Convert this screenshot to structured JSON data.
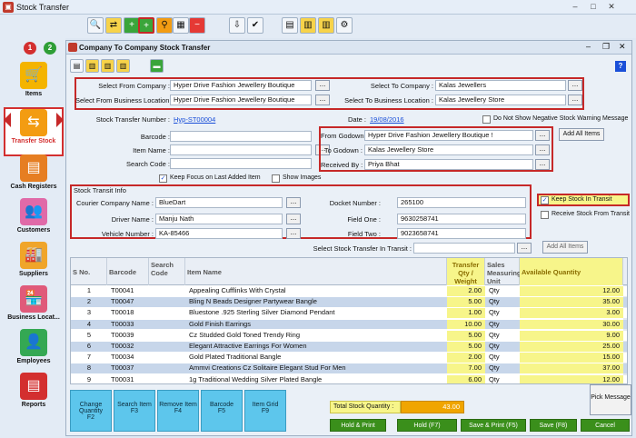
{
  "window": {
    "title": "Stock Transfer"
  },
  "sidebar": {
    "badges": [
      "1",
      "2"
    ],
    "items": [
      {
        "label": "Items"
      },
      {
        "label": "Transfer Stock"
      },
      {
        "label": "Cash Registers"
      },
      {
        "label": "Customers"
      },
      {
        "label": "Suppliers"
      },
      {
        "label": "Business Locat..."
      },
      {
        "label": "Employees"
      },
      {
        "label": "Reports"
      }
    ]
  },
  "form": {
    "title": "Company To Company Stock Transfer",
    "labels": {
      "from_company": "Select From Company :",
      "to_company": "Select To Company :",
      "from_loc": "Select From Business Location :",
      "to_loc": "Select To Business Location :",
      "transfer_no": "Stock Transfer Number :",
      "date": "Date :",
      "no_neg": "Do Not Show Negative Stock Warning Message",
      "barcode": "Barcode :",
      "item_name": "Item Name :",
      "search_code": "Search Code :",
      "from_godown": "From Godown :",
      "to_godown": "To Godown :",
      "received_by": "Received By :",
      "keep_focus": "Keep Focus on Last Added Item",
      "show_images": "Show Images",
      "transit_info": "Stock Transit Info",
      "courier": "Courier Company Name :",
      "driver": "Driver Name :",
      "vehicle": "Vehicle Number :",
      "docket": "Docket Number :",
      "field_one": "Field One :",
      "field_two": "Field Two :",
      "keep_transit": "Keep Stock In Transit",
      "receive_transit": "Receive Stock From Transit",
      "select_transit": "Select Stock Transfer In Transit :"
    },
    "values": {
      "from_company": "Hyper Drive Fashion Jewellery Boutique",
      "to_company": "Kalas Jewellers",
      "from_loc": "Hyper Drive Fashion Jewellery Boutique",
      "to_loc": "Kalas Jewellery Store",
      "transfer_no": "Hyp-ST00004",
      "date": "19/08/2016",
      "from_godown": "Hyper Drive Fashion Jewellery Boutique !",
      "to_godown": "Kalas Jewellery Store",
      "received_by": "Priya Bhat",
      "courier": "BlueDart",
      "driver": "Manju Nath",
      "vehicle": "KA-85466",
      "docket": "265100",
      "field_one": "9630258741",
      "field_two": "9023658741"
    },
    "buttons": {
      "add_all_items": "Add All Items",
      "add_all_items2": "Add All Items",
      "dots": "..."
    }
  },
  "grid": {
    "headers": [
      "S No.",
      "Barcode",
      "Search Code",
      "Item Name",
      "Transfer Qty / Weight",
      "Sales Measuring Unit",
      "Available Quantity"
    ],
    "rows": [
      [
        "1",
        "T00041",
        "",
        "Appealing Cufflinks With Crystal",
        "2.00",
        "Qty",
        "12.00"
      ],
      [
        "2",
        "T00047",
        "",
        "Bling N Beads Designer Partywear Bangle",
        "5.00",
        "Qty",
        "35.00"
      ],
      [
        "3",
        "T00018",
        "",
        "Bluestone .925 Sterling Silver Diamond Pendant",
        "1.00",
        "Qty",
        "3.00"
      ],
      [
        "4",
        "T00033",
        "",
        "Gold Finish Earrings",
        "10.00",
        "Qty",
        "30.00"
      ],
      [
        "5",
        "T00039",
        "",
        "Cz Studded Gold Toned Trendy Ring",
        "5.00",
        "Qty",
        "9.00"
      ],
      [
        "6",
        "T00032",
        "",
        "Elegant Attractive Earrings For Women",
        "5.00",
        "Qty",
        "25.00"
      ],
      [
        "7",
        "T00034",
        "",
        "Gold Plated Traditional Bangle",
        "2.00",
        "Qty",
        "15.00"
      ],
      [
        "8",
        "T00037",
        "",
        "Ammvi Creations Cz Solitaire Elegant Stud For Men",
        "7.00",
        "Qty",
        "37.00"
      ],
      [
        "9",
        "T00031",
        "",
        "1g Traditional Wedding Silver Plated Bangle",
        "6.00",
        "Qty",
        "12.00"
      ]
    ]
  },
  "footer": {
    "fkeys": [
      {
        "label": "Change Quantity",
        "key": "F2"
      },
      {
        "label": "Search Item",
        "key": "F3"
      },
      {
        "label": "Remove Item",
        "key": "F4"
      },
      {
        "label": "Barcode",
        "key": "F5"
      },
      {
        "label": "Item Grid",
        "key": "F9"
      }
    ],
    "total_label": "Total Stock Quantity :",
    "total_value": "43.00",
    "pick_message": "Pick Message",
    "actions": [
      "Hold & Print",
      "Hold (F7)",
      "Save & Print (F5)",
      "Save (F8)",
      "Cancel"
    ]
  },
  "colors": {
    "accent_red": "#c62828",
    "grid_yellow": "#f7f58a",
    "row_blue": "#c7d6ea",
    "fkey_blue": "#5dc6ec",
    "action_green": "#3a8f1b"
  }
}
